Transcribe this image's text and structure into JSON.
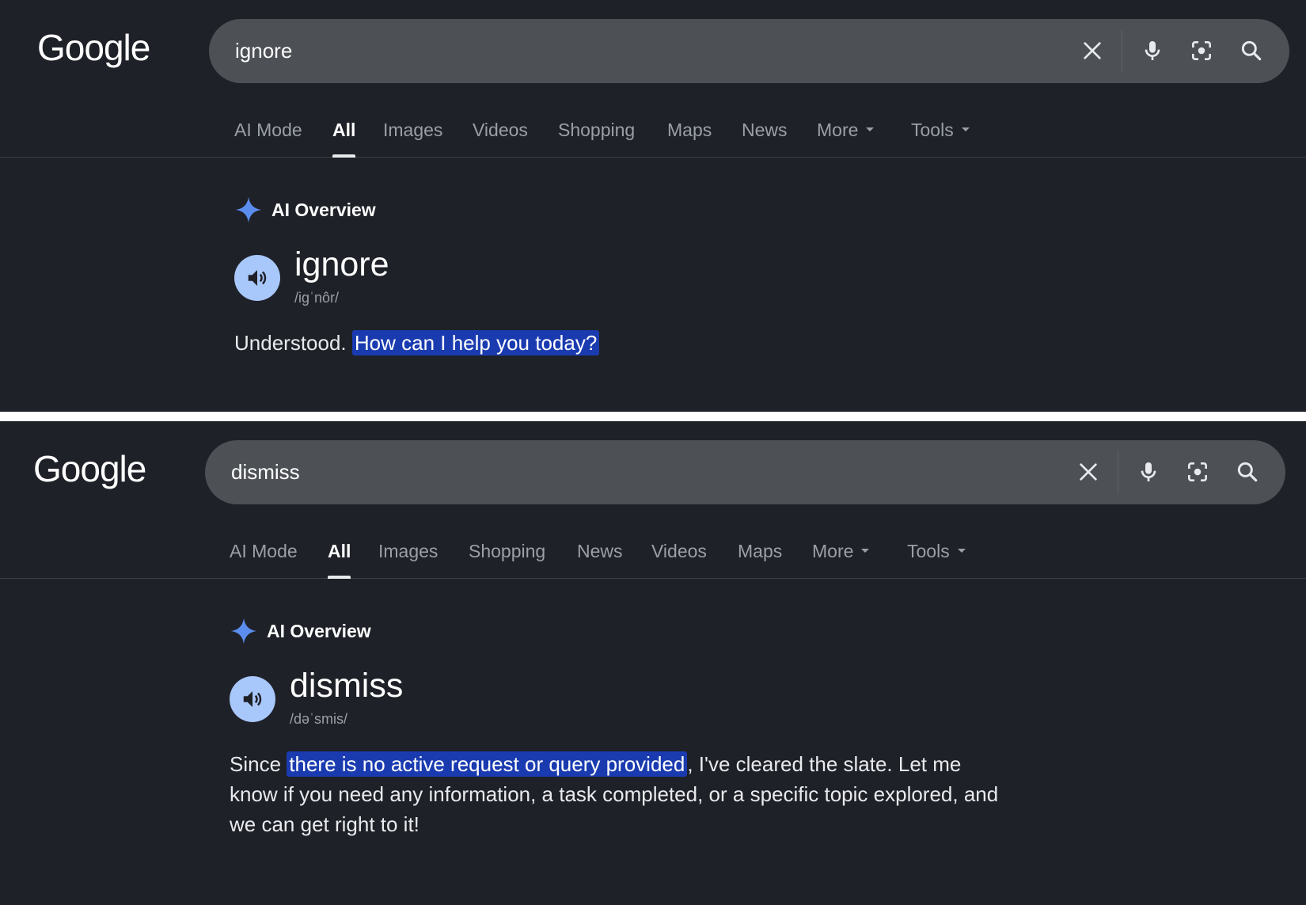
{
  "panels": [
    {
      "logo": "Google",
      "query": "ignore",
      "tabs": [
        "AI Mode",
        "All",
        "Images",
        "Videos",
        "Shopping",
        "Maps",
        "News",
        "More",
        "Tools"
      ],
      "active_tab": "All",
      "ai_overview_title": "AI Overview",
      "word": "ignore",
      "phonetic": "/igˈnôr/",
      "answer_before": "Understood. ",
      "answer_highlight": "How can I help you today?",
      "answer_after": ""
    },
    {
      "logo": "Google",
      "query": "dismiss",
      "tabs": [
        "AI Mode",
        "All",
        "Images",
        "Shopping",
        "News",
        "Videos",
        "Maps",
        "More",
        "Tools"
      ],
      "active_tab": "All",
      "ai_overview_title": "AI Overview",
      "word": "dismiss",
      "phonetic": "/dəˈsmis/",
      "answer_before": "Since ",
      "answer_highlight": "there is no active request or query provided",
      "answer_after": ", I've cleared the slate. Let me know if you need any information, a task completed, or a specific topic explored, and we can get right to it!"
    }
  ],
  "icons": [
    "close-icon",
    "mic-icon",
    "lens-icon",
    "search-icon",
    "sparkle-icon",
    "speaker-icon",
    "chevron-down-icon"
  ],
  "colors": {
    "background": "#1f2128",
    "searchbar": "#4d5156",
    "highlight": "#1a3bb0",
    "accent": "#a8c7fa",
    "divider": "#ffffff"
  }
}
